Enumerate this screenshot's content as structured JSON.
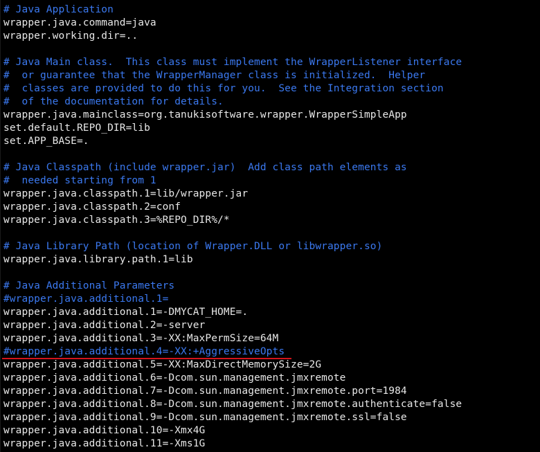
{
  "colors": {
    "background": "#000000",
    "text": "#e8e8e8",
    "comment": "#3b79f0",
    "highlight_underline": "#d3141b"
  },
  "lines": [
    {
      "text": "# Java Application",
      "kind": "comment"
    },
    {
      "text": "wrapper.java.command=java",
      "kind": "plain"
    },
    {
      "text": "wrapper.working.dir=..",
      "kind": "plain"
    },
    {
      "text": "",
      "kind": "blank"
    },
    {
      "text": "# Java Main class.  This class must implement the WrapperListener interface",
      "kind": "comment"
    },
    {
      "text": "#  or guarantee that the WrapperManager class is initialized.  Helper",
      "kind": "comment"
    },
    {
      "text": "#  classes are provided to do this for you.  See the Integration section",
      "kind": "comment"
    },
    {
      "text": "#  of the documentation for details.",
      "kind": "comment"
    },
    {
      "text": "wrapper.java.mainclass=org.tanukisoftware.wrapper.WrapperSimpleApp",
      "kind": "plain"
    },
    {
      "text": "set.default.REPO_DIR=lib",
      "kind": "plain"
    },
    {
      "text": "set.APP_BASE=.",
      "kind": "plain"
    },
    {
      "text": "",
      "kind": "blank"
    },
    {
      "text": "# Java Classpath (include wrapper.jar)  Add class path elements as",
      "kind": "comment"
    },
    {
      "text": "#  needed starting from 1",
      "kind": "comment"
    },
    {
      "text": "wrapper.java.classpath.1=lib/wrapper.jar",
      "kind": "plain"
    },
    {
      "text": "wrapper.java.classpath.2=conf",
      "kind": "plain"
    },
    {
      "text": "wrapper.java.classpath.3=%REPO_DIR%/*",
      "kind": "plain"
    },
    {
      "text": "",
      "kind": "blank"
    },
    {
      "text": "# Java Library Path (location of Wrapper.DLL or libwrapper.so)",
      "kind": "comment"
    },
    {
      "text": "wrapper.java.library.path.1=lib",
      "kind": "plain"
    },
    {
      "text": "",
      "kind": "blank"
    },
    {
      "text": "# Java Additional Parameters",
      "kind": "comment"
    },
    {
      "text": "#wrapper.java.additional.1=",
      "kind": "comment"
    },
    {
      "text": "wrapper.java.additional.1=-DMYCAT_HOME=.",
      "kind": "plain"
    },
    {
      "text": "wrapper.java.additional.2=-server",
      "kind": "plain"
    },
    {
      "text": "wrapper.java.additional.3=-XX:MaxPermSize=64M",
      "kind": "plain"
    },
    {
      "text": "#wrapper.java.additional.4=-XX:+AggressiveOpts",
      "kind": "comment",
      "highlighted": true
    },
    {
      "text": "wrapper.java.additional.5=-XX:MaxDirectMemorySize=2G",
      "kind": "plain"
    },
    {
      "text": "wrapper.java.additional.6=-Dcom.sun.management.jmxremote",
      "kind": "plain"
    },
    {
      "text": "wrapper.java.additional.7=-Dcom.sun.management.jmxremote.port=1984",
      "kind": "plain"
    },
    {
      "text": "wrapper.java.additional.8=-Dcom.sun.management.jmxremote.authenticate=false",
      "kind": "plain"
    },
    {
      "text": "wrapper.java.additional.9=-Dcom.sun.management.jmxremote.ssl=false",
      "kind": "plain"
    },
    {
      "text": "wrapper.java.additional.10=-Xmx4G",
      "kind": "plain"
    },
    {
      "text": "wrapper.java.additional.11=-Xms1G",
      "kind": "plain"
    }
  ]
}
